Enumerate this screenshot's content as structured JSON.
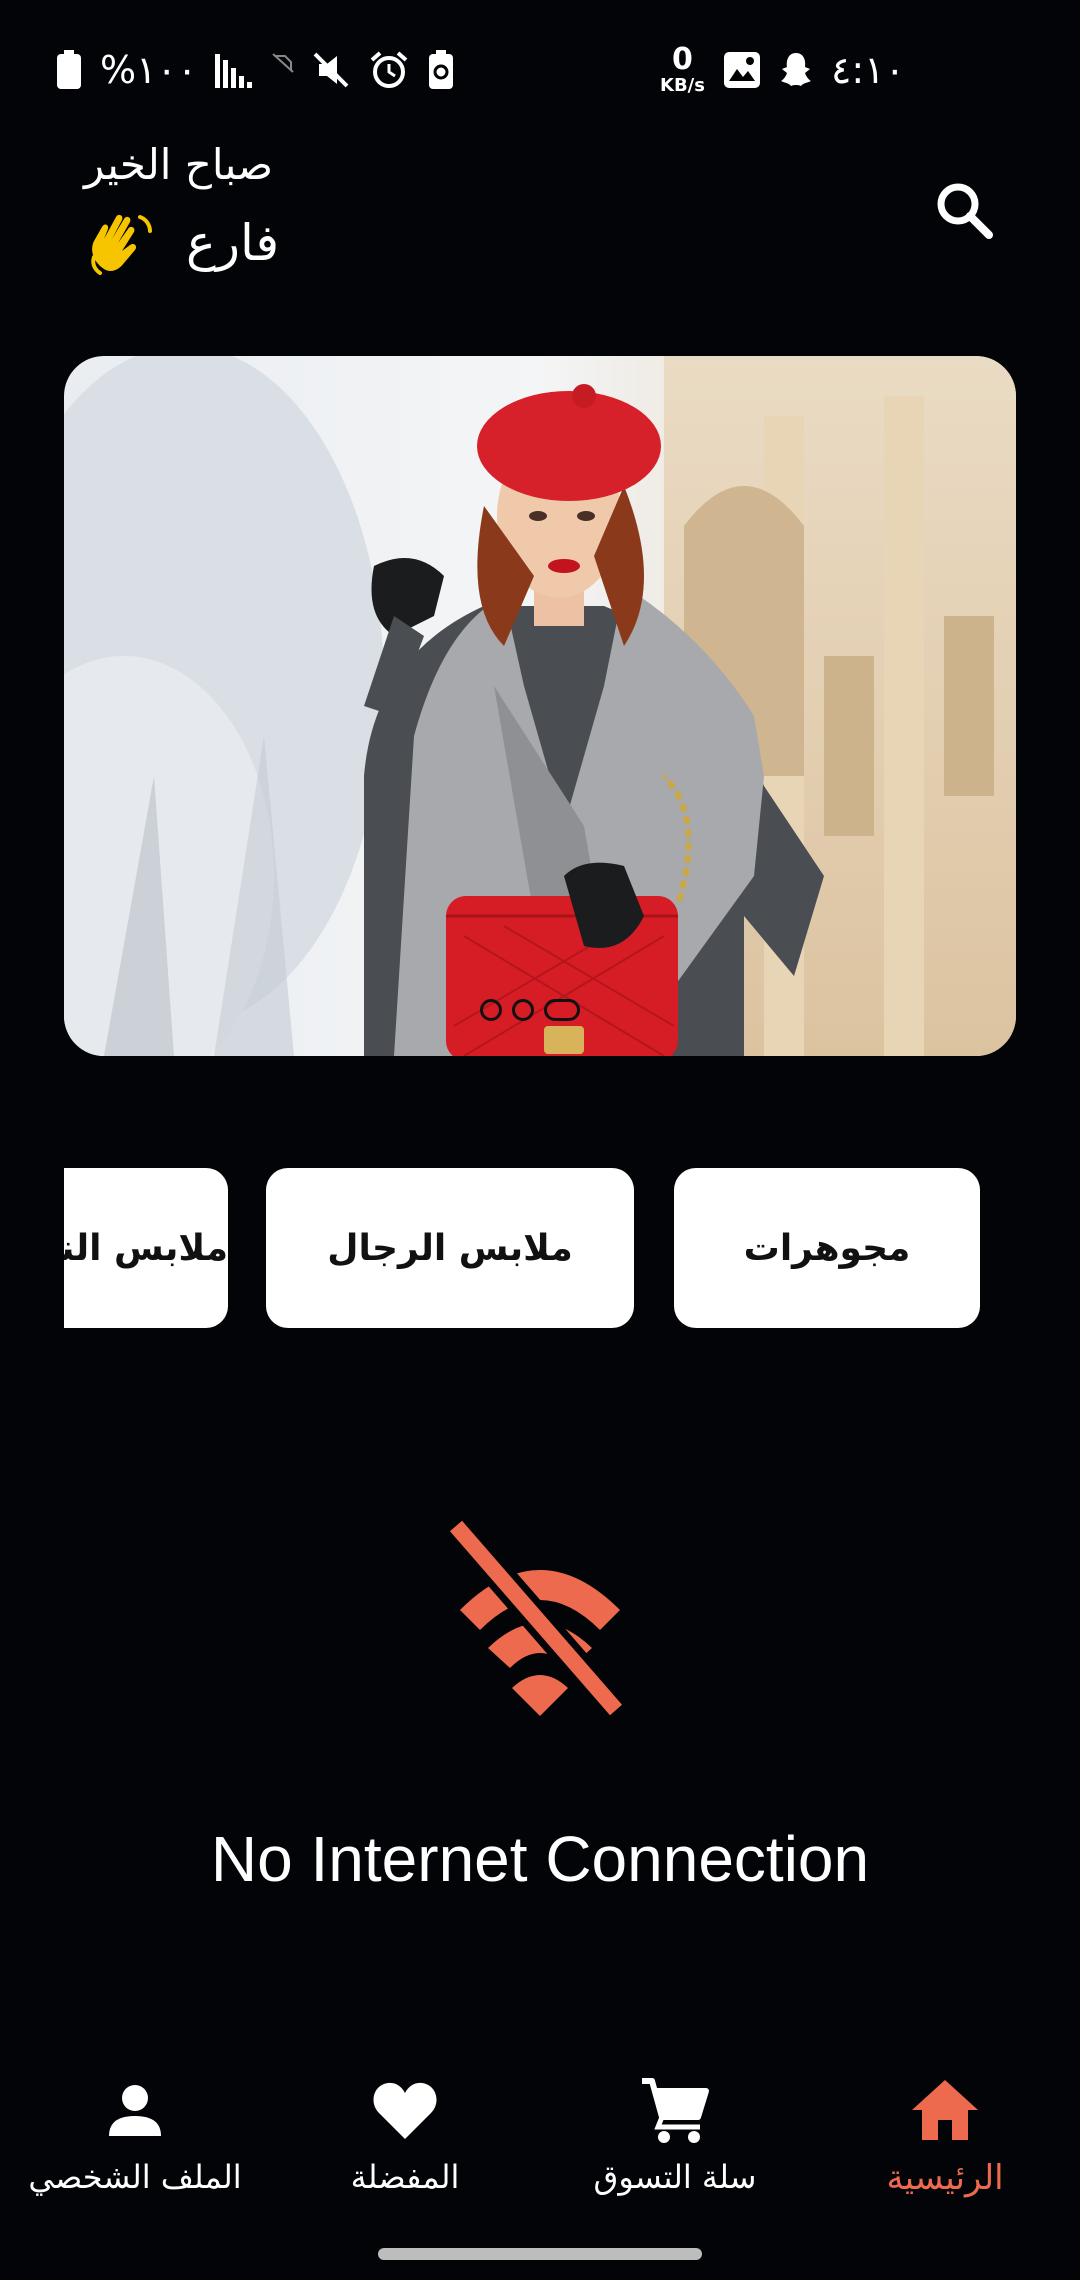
{
  "status_bar": {
    "battery_text": "%١٠٠",
    "time": "٤:١٠",
    "net_speed_value": "0",
    "net_speed_unit": "KB/s"
  },
  "header": {
    "greeting": "صباح الخير",
    "user_name": "فارع"
  },
  "banner": {
    "slides_count": 3,
    "active_slide": 3
  },
  "categories": [
    {
      "label": "مجوهرات"
    },
    {
      "label": "ملابس الرجال"
    },
    {
      "label": "ملابس النساء"
    }
  ],
  "no_internet": {
    "message": "No Internet Connection"
  },
  "bottom_nav": {
    "profile": "الملف الشخصي",
    "favorites": "المفضلة",
    "cart": "سلة التسوق",
    "home": "الرئيسية"
  },
  "colors": {
    "accent": "#ee6a4f",
    "background": "#020407",
    "card": "#ffffff"
  }
}
